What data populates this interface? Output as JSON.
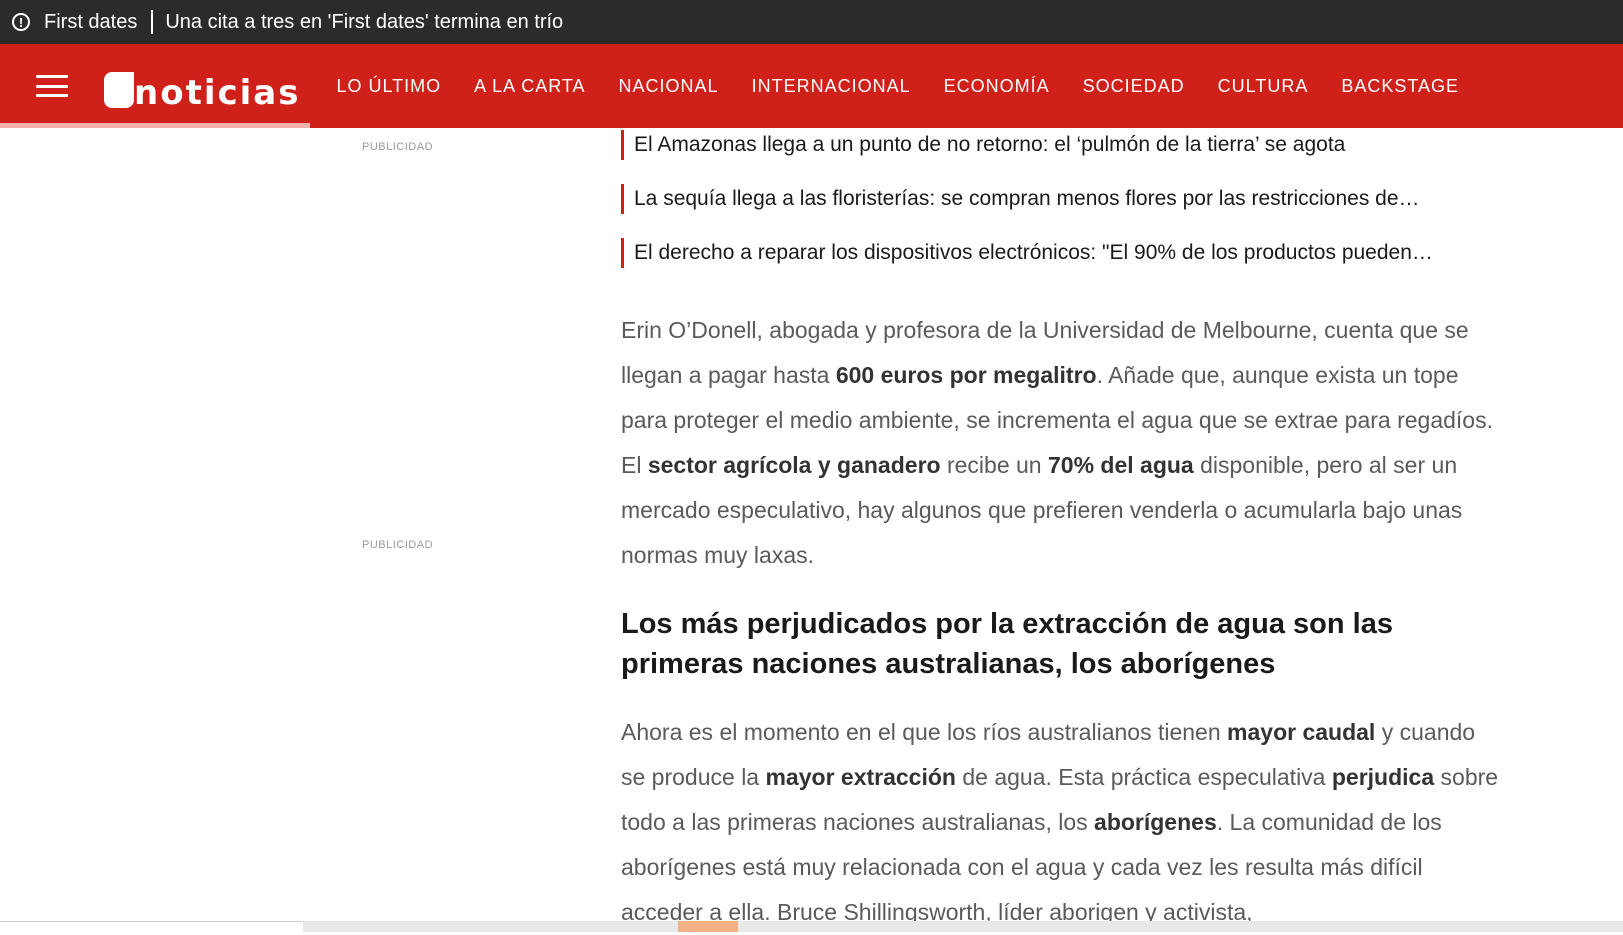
{
  "topbar": {
    "section": "First dates",
    "headline": "Una cita a tres en 'First dates' termina en trío"
  },
  "navbar": {
    "logo_text": "noticias",
    "links": [
      "LO ÚLTIMO",
      "A LA CARTA",
      "NACIONAL",
      "INTERNACIONAL",
      "ECONOMÍA",
      "SOCIEDAD",
      "CULTURA",
      "BACKSTAGE"
    ]
  },
  "ads": {
    "label_1": "PUBLICIDAD",
    "label_2": "PUBLICIDAD"
  },
  "related": [
    "El Amazonas llega a un punto de no retorno: el ‘pulmón de la tierra’ se agota",
    "La sequía llega a las floristerías: se compran menos flores por las restricciones de…",
    "El derecho a reparar los dispositivos electrónicos: \"El 90% de los productos pueden…"
  ],
  "article": {
    "p1": {
      "t1": "Erin O’Donell, abogada y profesora de la Universidad de Melbourne, cuenta que se llegan a pagar hasta ",
      "b1": "600 euros por megalitro",
      "t2": ". Añade que, aunque exista un tope para proteger el medio ambiente, se incrementa el agua que se extrae para regadíos. El ",
      "b2": "sector agrícola y ganadero",
      "t3": " recibe un ",
      "b3": "70% del agua",
      "t4": " disponible, pero al ser un mercado especulativo, hay algunos que prefieren venderla o acumularla bajo unas normas muy laxas."
    },
    "heading": "Los más perjudicados por la extracción de agua son las primeras naciones australianas, los aborígenes",
    "p2": {
      "t1": "Ahora es el momento en el que los ríos australianos tienen ",
      "b1": "mayor caudal",
      "t2": " y cuando se produce la ",
      "b2": "mayor extracción",
      "t3": " de agua. Esta práctica especulativa ",
      "b3": "perjudica",
      "t4": " sobre todo a las primeras naciones australianas, los ",
      "b4": "aborígenes",
      "t5": ". La comunidad de los aborígenes está muy relacionada con el agua y cada vez les resulta más difícil acceder a ella. Bruce Shillingsworth, líder aborigen y activista,"
    }
  },
  "colors": {
    "brand_red": "#d0201a",
    "topbar_bg": "#2b2b2b"
  },
  "icons": {
    "alert": "alert-circle-icon",
    "menu": "hamburger-menu-icon"
  }
}
